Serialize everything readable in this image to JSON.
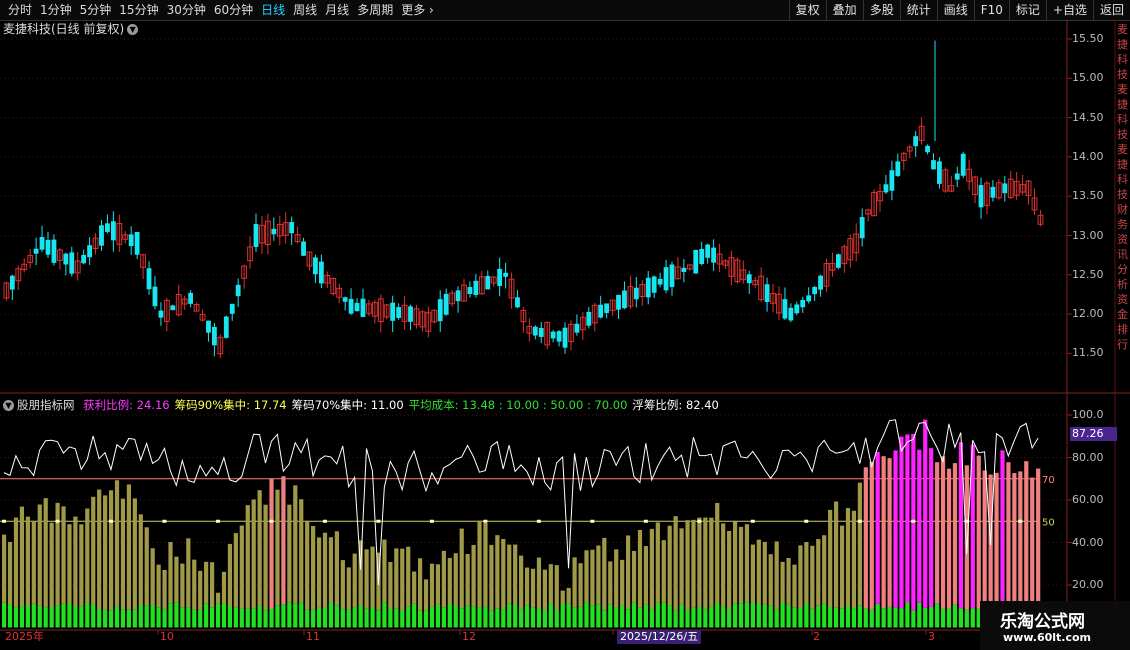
{
  "toolbar": {
    "periods": [
      "分时",
      "1分钟",
      "5分钟",
      "15分钟",
      "30分钟",
      "60分钟",
      "日线",
      "周线",
      "月线",
      "多周期",
      "更多"
    ],
    "active_period": "日线",
    "right_buttons": [
      "复权",
      "叠加",
      "多股",
      "统计",
      "画线",
      "F10",
      "标记",
      "+自选",
      "返回"
    ]
  },
  "stock": {
    "title": "麦捷科技(日线 前复权)"
  },
  "indicator": {
    "name": "股朋指标网",
    "items": [
      {
        "label": "获利比例: 24.16",
        "color": "#ff3cff"
      },
      {
        "label": "筹码90%集中: 17.74",
        "color": "#ffff55"
      },
      {
        "label": "筹码70%集中: 11.00",
        "color": "#ffffff"
      },
      {
        "label": "平均成本: 13.48 : 10.00 : 50.00 : 70.00",
        "color": "#33dd33"
      },
      {
        "label": "浮筹比例: 82.40",
        "color": "#ffffff"
      }
    ],
    "current_value": "87.26",
    "ref_lines": [
      "70",
      "50"
    ]
  },
  "price_axis": [
    "15.50",
    "15.00",
    "14.50",
    "14.00",
    "13.50",
    "13.00",
    "12.50",
    "12.00",
    "11.50"
  ],
  "ind_axis": [
    "100.0",
    "80.00",
    "60.00",
    "40.00",
    "20.00"
  ],
  "dates": [
    {
      "label": "2025年",
      "hl": false
    },
    {
      "label": "10",
      "hl": false
    },
    {
      "label": "11",
      "hl": false
    },
    {
      "label": "12",
      "hl": false
    },
    {
      "label": "2025/12/26/五",
      "hl": true
    },
    {
      "label": "2",
      "hl": false
    },
    {
      "label": "3",
      "hl": false
    }
  ],
  "watermark": {
    "line1": "乐淘公式网",
    "line2": "www.60lt.com"
  },
  "colors": {
    "up": "#e03030",
    "down": "#17e6f0",
    "profit": "#ff22ff",
    "salmon": "#f08080",
    "olive": "#a09a48",
    "green": "#22e022"
  }
}
